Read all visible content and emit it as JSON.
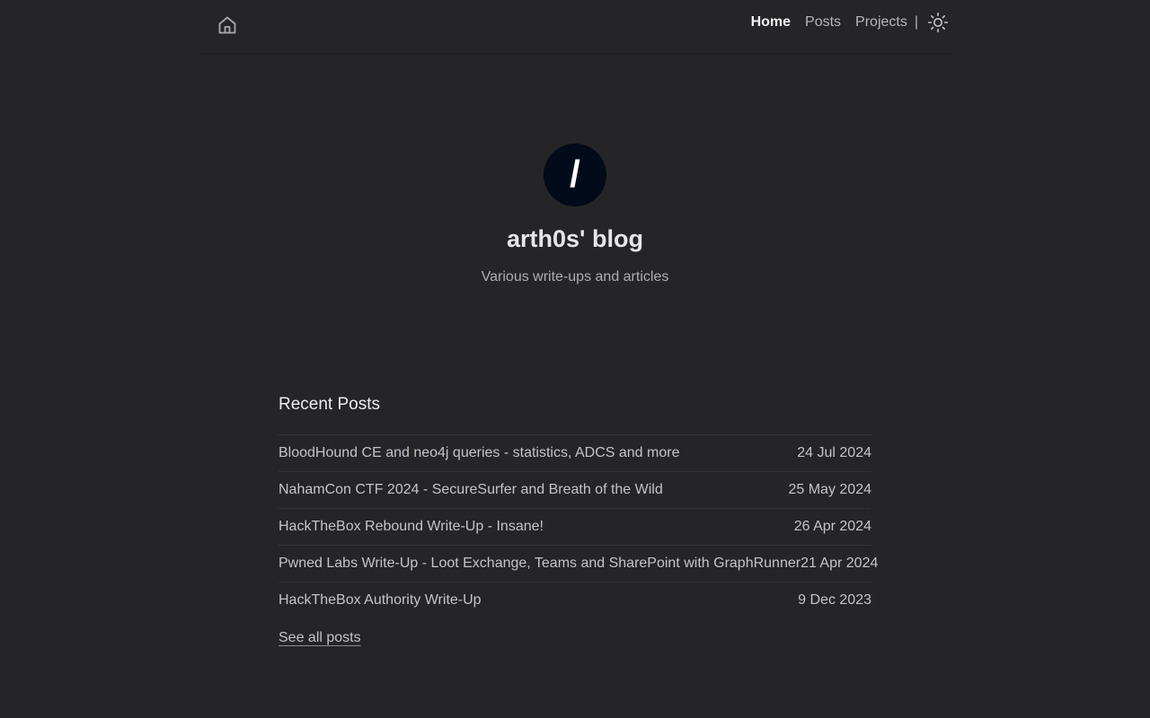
{
  "header": {
    "home_icon": "home-icon",
    "nav": [
      {
        "label": "Home",
        "active": true
      },
      {
        "label": "Posts",
        "active": false
      },
      {
        "label": "Projects",
        "active": false
      }
    ],
    "separator": "|",
    "theme_icon": "sun-icon"
  },
  "hero": {
    "avatar_glyph": "/",
    "title": "arth0s' blog",
    "description": "Various write-ups and articles"
  },
  "recent": {
    "heading": "Recent Posts",
    "posts": [
      {
        "title": "BloodHound CE and neo4j queries - statistics, ADCS and more",
        "date": "24 Jul 2024"
      },
      {
        "title": "NahamCon CTF 2024 - SecureSurfer and Breath of the Wild",
        "date": "25 May 2024"
      },
      {
        "title": "HackTheBox Rebound Write-Up - Insane!",
        "date": "26 Apr 2024"
      },
      {
        "title": "Pwned Labs Write-Up - Loot Exchange, Teams and SharePoint with GraphRunner",
        "date": "21 Apr 2024"
      },
      {
        "title": "HackTheBox Authority Write-Up",
        "date": "9 Dec 2023"
      }
    ],
    "see_all": "See all posts"
  },
  "colors": {
    "background": "#252528",
    "avatar_bg": "#030b1a",
    "text": "#d6d6d9"
  }
}
